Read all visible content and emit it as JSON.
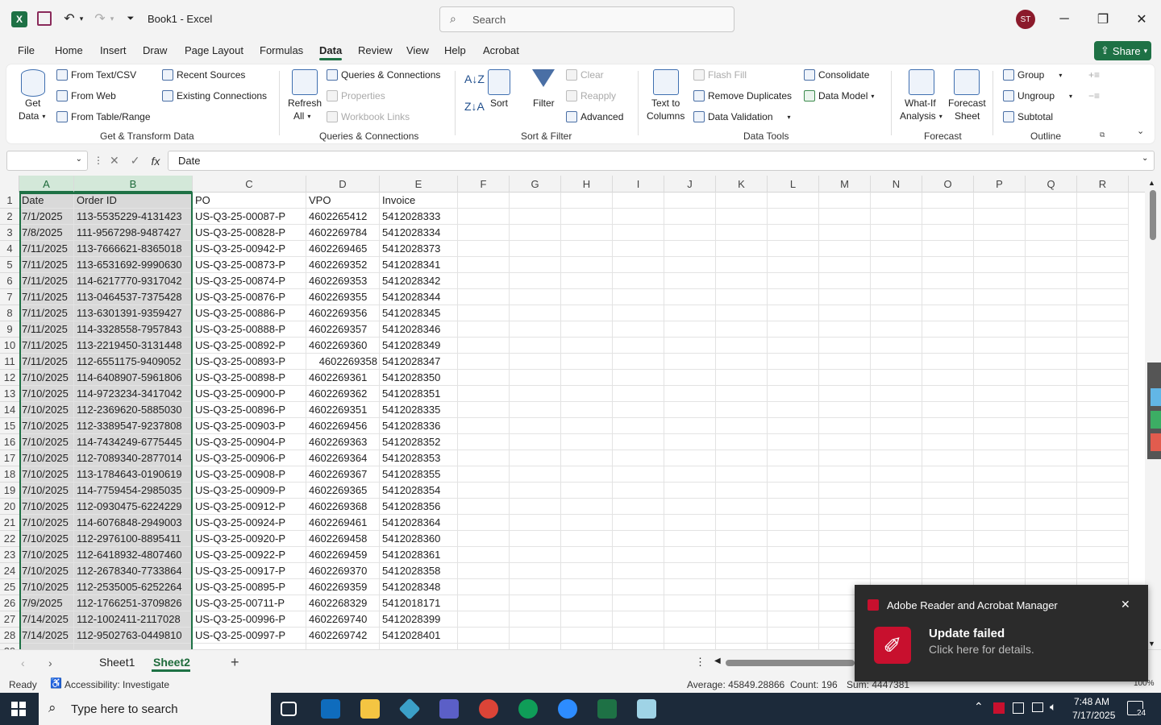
{
  "app": {
    "title": "Book1 - Excel",
    "search_placeholder": "Search",
    "avatar_initials": "ST",
    "share_label": "Share"
  },
  "menu_tabs": [
    "File",
    "Home",
    "Insert",
    "Draw",
    "Page Layout",
    "Formulas",
    "Data",
    "Review",
    "View",
    "Help",
    "Acrobat"
  ],
  "active_tab": "Data",
  "ribbon": {
    "get_data": "Get",
    "get_data2": "Data",
    "from_text_csv": "From Text/CSV",
    "from_web": "From Web",
    "from_table_range": "From Table/Range",
    "recent_sources": "Recent Sources",
    "existing_connections": "Existing Connections",
    "group_get_transform": "Get & Transform Data",
    "refresh_all": "Refresh",
    "refresh_all2": "All",
    "queries_connections": "Queries & Connections",
    "properties": "Properties",
    "workbook_links": "Workbook Links",
    "group_queries": "Queries & Connections",
    "sort": "Sort",
    "filter": "Filter",
    "clear": "Clear",
    "reapply": "Reapply",
    "advanced": "Advanced",
    "group_sort_filter": "Sort & Filter",
    "text_to_columns": "Text to",
    "text_to_columns2": "Columns",
    "flash_fill": "Flash Fill",
    "remove_duplicates": "Remove Duplicates",
    "data_validation": "Data Validation",
    "consolidate": "Consolidate",
    "data_model": "Data Model",
    "group_data_tools": "Data Tools",
    "what_if": "What-If",
    "what_if2": "Analysis",
    "forecast_sheet": "Forecast",
    "forecast_sheet2": "Sheet",
    "group_forecast": "Forecast",
    "group": "Group",
    "ungroup": "Ungroup",
    "subtotal": "Subtotal",
    "group_outline": "Outline"
  },
  "formula_bar": {
    "name_box": "",
    "content": "Date"
  },
  "columns": [
    "A",
    "B",
    "C",
    "D",
    "E",
    "F",
    "G",
    "H",
    "I",
    "J",
    "K",
    "L",
    "M",
    "N",
    "O",
    "P",
    "Q",
    "R"
  ],
  "header_row": [
    "Date",
    "Order ID",
    "PO",
    "VPO",
    "Invoice"
  ],
  "rows": [
    [
      "7/1/2025",
      "113-5535229-4131423",
      "US-Q3-25-00087-P",
      "4602265412",
      "5412028333"
    ],
    [
      "7/8/2025",
      "111-9567298-9487427",
      "US-Q3-25-00828-P",
      "4602269784",
      "5412028334"
    ],
    [
      "7/11/2025",
      "113-7666621-8365018",
      "US-Q3-25-00942-P",
      "4602269465",
      "5412028373"
    ],
    [
      "7/11/2025",
      "113-6531692-9990630",
      "US-Q3-25-00873-P",
      "4602269352",
      "5412028341"
    ],
    [
      "7/11/2025",
      "114-6217770-9317042",
      "US-Q3-25-00874-P",
      "4602269353",
      "5412028342"
    ],
    [
      "7/11/2025",
      "113-0464537-7375428",
      "US-Q3-25-00876-P",
      "4602269355",
      "5412028344"
    ],
    [
      "7/11/2025",
      "113-6301391-9359427",
      "US-Q3-25-00886-P",
      "4602269356",
      "5412028345"
    ],
    [
      "7/11/2025",
      "114-3328558-7957843",
      "US-Q3-25-00888-P",
      "4602269357",
      "5412028346"
    ],
    [
      "7/11/2025",
      "113-2219450-3131448",
      "US-Q3-25-00892-P",
      "4602269360",
      "5412028349"
    ],
    [
      "7/11/2025",
      "112-6551175-9409052",
      "US-Q3-25-00893-P",
      "4602269358",
      "5412028347"
    ],
    [
      "7/10/2025",
      "114-6408907-5961806",
      "US-Q3-25-00898-P",
      "4602269361",
      "5412028350"
    ],
    [
      "7/10/2025",
      "114-9723234-3417042",
      "US-Q3-25-00900-P",
      "4602269362",
      "5412028351"
    ],
    [
      "7/10/2025",
      "112-2369620-5885030",
      "US-Q3-25-00896-P",
      "4602269351",
      "5412028335"
    ],
    [
      "7/10/2025",
      "112-3389547-9237808",
      "US-Q3-25-00903-P",
      "4602269456",
      "5412028336"
    ],
    [
      "7/10/2025",
      "114-7434249-6775445",
      "US-Q3-25-00904-P",
      "4602269363",
      "5412028352"
    ],
    [
      "7/10/2025",
      "112-7089340-2877014",
      "US-Q3-25-00906-P",
      "4602269364",
      "5412028353"
    ],
    [
      "7/10/2025",
      "113-1784643-0190619",
      "US-Q3-25-00908-P",
      "4602269367",
      "5412028355"
    ],
    [
      "7/10/2025",
      "114-7759454-2985035",
      "US-Q3-25-00909-P",
      "4602269365",
      "5412028354"
    ],
    [
      "7/10/2025",
      "112-0930475-6224229",
      "US-Q3-25-00912-P",
      "4602269368",
      "5412028356"
    ],
    [
      "7/10/2025",
      "114-6076848-2949003",
      "US-Q3-25-00924-P",
      "4602269461",
      "5412028364"
    ],
    [
      "7/10/2025",
      "112-2976100-8895411",
      "US-Q3-25-00920-P",
      "4602269458",
      "5412028360"
    ],
    [
      "7/10/2025",
      "112-6418932-4807460",
      "US-Q3-25-00922-P",
      "4602269459",
      "5412028361"
    ],
    [
      "7/10/2025",
      "112-2678340-7733864",
      "US-Q3-25-00917-P",
      "4602269370",
      "5412028358"
    ],
    [
      "7/10/2025",
      "112-2535005-6252264",
      "US-Q3-25-00895-P",
      "4602269359",
      "5412028348"
    ],
    [
      "7/9/2025",
      "112-1766251-3709826",
      "US-Q3-25-00711-P",
      "4602268329",
      "5412018171"
    ],
    [
      "7/14/2025",
      "112-1002411-2117028",
      "US-Q3-25-00996-P",
      "4602269740",
      "5412028399"
    ],
    [
      "7/14/2025",
      "112-9502763-0449810",
      "US-Q3-25-00997-P",
      "4602269742",
      "5412028401"
    ]
  ],
  "sheets": [
    "Sheet1",
    "Sheet2"
  ],
  "active_sheet": "Sheet2",
  "status": {
    "ready": "Ready",
    "accessibility": "Accessibility: Investigate",
    "average": "Average: 45849.28866",
    "count": "Count: 196",
    "sum": "Sum: 4447381",
    "zoom": "100%"
  },
  "toast": {
    "app": "Adobe Reader and Acrobat Manager",
    "title": "Update failed",
    "body": "Click here for details."
  },
  "taskbar": {
    "search_placeholder": "Type here to search",
    "time": "7:48 AM",
    "date": "7/17/2025",
    "notif_count": "24"
  },
  "colors": {
    "excel_green": "#1e7145",
    "taskbar": "#1c2a3a",
    "toast_bg": "#2b2b2b",
    "acrobat_red": "#c8102e"
  }
}
